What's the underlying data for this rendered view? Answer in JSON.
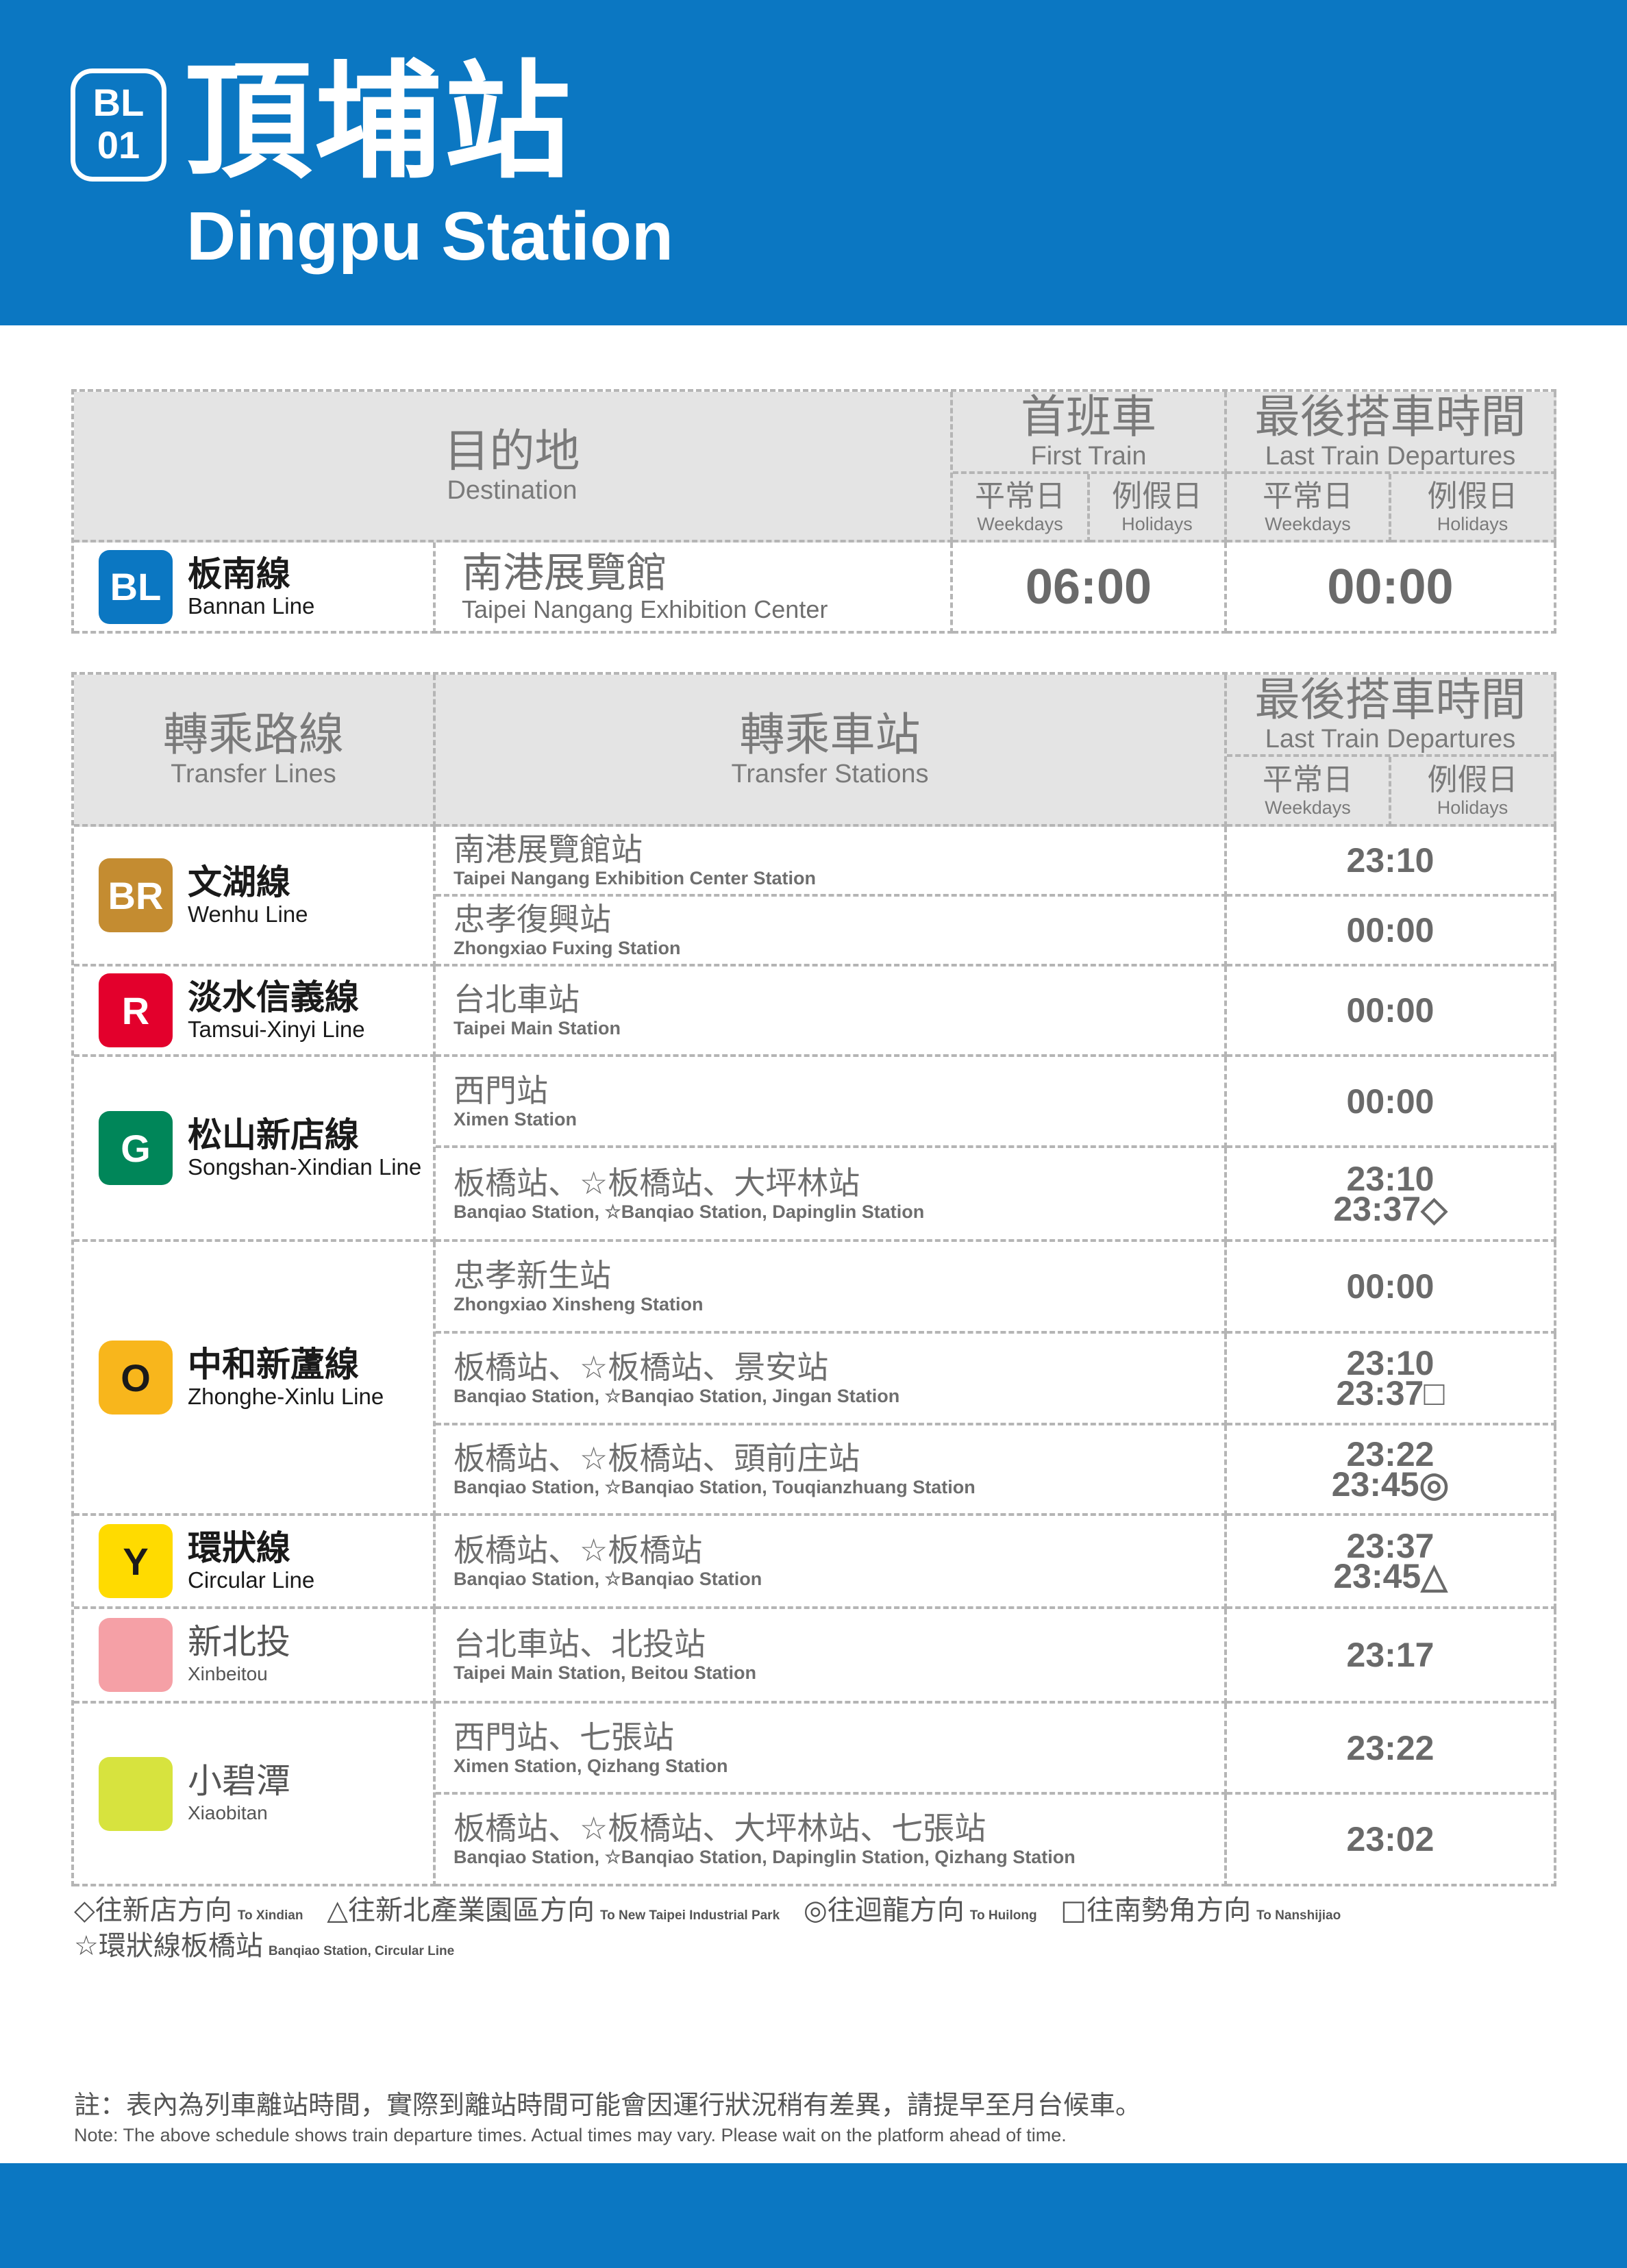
{
  "header": {
    "code_line": "BL",
    "code_num": "01",
    "station_zh": "頂埔站",
    "station_en": "Dingpu Station",
    "color": "#0b77c2"
  },
  "top_table": {
    "dest_zh": "目的地",
    "dest_en": "Destination",
    "first_zh": "首班車",
    "first_en": "First Train",
    "last_zh": "最後搭車時間",
    "last_en": "Last Train Departures",
    "weekdays_zh": "平常日",
    "weekdays_en": "Weekdays",
    "holidays_zh": "例假日",
    "holidays_en": "Holidays",
    "row": {
      "badge": "BL",
      "badge_color": "#0b77c2",
      "line_zh": "板南線",
      "line_en": "Bannan Line",
      "dest_zh": "南港展覽館",
      "dest_en": "Taipei Nangang Exhibition Center",
      "first_time": "06:00",
      "last_time": "00:00"
    }
  },
  "transfer_table": {
    "lines_zh": "轉乘路線",
    "lines_en": "Transfer Lines",
    "stations_zh": "轉乘車站",
    "stations_en": "Transfer Stations",
    "last_zh": "最後搭車時間",
    "last_en": "Last Train Departures",
    "weekdays_zh": "平常日",
    "weekdays_en": "Weekdays",
    "holidays_zh": "例假日",
    "holidays_en": "Holidays",
    "lines": [
      {
        "badge": "BR",
        "color": "#c48c31",
        "zh": "文湖線",
        "en": "Wenhu Line"
      },
      {
        "badge": "R",
        "color": "#e3002c",
        "zh": "淡水信義線",
        "en": "Tamsui-Xinyi Line"
      },
      {
        "badge": "G",
        "color": "#008659",
        "zh": "松山新店線",
        "en": "Songshan-Xindian Line"
      },
      {
        "badge": "O",
        "color": "#f8b61c",
        "zh": "中和新蘆線",
        "en": "Zhonghe-Xinlu Line"
      },
      {
        "badge": "Y",
        "color": "#ffdb00",
        "zh": "環狀線",
        "en": "Circular Line"
      },
      {
        "badge": "",
        "color": "#f5a0a6",
        "zh": "新北投",
        "en": "Xinbeitou"
      },
      {
        "badge": "",
        "color": "#d7e33e",
        "zh": "小碧潭",
        "en": "Xiaobitan"
      }
    ],
    "rows": [
      {
        "zh": "南港展覽館站",
        "en": "Taipei Nangang Exhibition Center Station",
        "t1": "23:10",
        "t2": ""
      },
      {
        "zh": "忠孝復興站",
        "en": "Zhongxiao Fuxing Station",
        "t1": "00:00",
        "t2": ""
      },
      {
        "zh": "台北車站",
        "en": "Taipei Main Station",
        "t1": "00:00",
        "t2": ""
      },
      {
        "zh": "西門站",
        "en": "Ximen Station",
        "t1": "00:00",
        "t2": ""
      },
      {
        "zh": "板橋站、☆板橋站、大坪林站",
        "en": "Banqiao Station, ☆Banqiao Station, Dapinglin Station",
        "t1": "23:10",
        "t2": "23:37◇"
      },
      {
        "zh": "忠孝新生站",
        "en": "Zhongxiao Xinsheng Station",
        "t1": "00:00",
        "t2": ""
      },
      {
        "zh": "板橋站、☆板橋站、景安站",
        "en": "Banqiao Station, ☆Banqiao Station, Jingan Station",
        "t1": "23:10",
        "t2": "23:37□"
      },
      {
        "zh": "板橋站、☆板橋站、頭前庄站",
        "en": "Banqiao Station, ☆Banqiao Station, Touqianzhuang Station",
        "t1": "23:22",
        "t2": "23:45◎"
      },
      {
        "zh": "板橋站、☆板橋站",
        "en": "Banqiao Station, ☆Banqiao Station",
        "t1": "23:37",
        "t2": "23:45△"
      },
      {
        "zh": "台北車站、北投站",
        "en": "Taipei Main Station, Beitou Station",
        "t1": "23:17",
        "t2": ""
      },
      {
        "zh": "西門站、七張站",
        "en": "Ximen Station, Qizhang Station",
        "t1": "23:22",
        "t2": ""
      },
      {
        "zh": "板橋站、☆板橋站、大坪林站、七張站",
        "en": "Banqiao Station, ☆Banqiao Station, Dapinglin Station, Qizhang Station",
        "t1": "23:02",
        "t2": ""
      }
    ]
  },
  "legend": {
    "items": [
      {
        "zh": "◇往新店方向",
        "en": "To Xindian"
      },
      {
        "zh": "△往新北產業園區方向",
        "en": "To New Taipei Industrial Park"
      },
      {
        "zh": "◎往迴龍方向",
        "en": "To Huilong"
      },
      {
        "zh": "□往南勢角方向",
        "en": "To Nanshijiao"
      }
    ],
    "star_zh": "☆環狀線板橋站",
    "star_en": "Banqiao Station, Circular Line"
  },
  "note": {
    "zh": "註：表內為列車離站時間，實際到離站時間可能會因運行狀況稍有差異，請提早至月台候車。",
    "en": "Note: The above schedule shows train departure times. Actual times may vary. Please wait on the platform ahead of time."
  }
}
